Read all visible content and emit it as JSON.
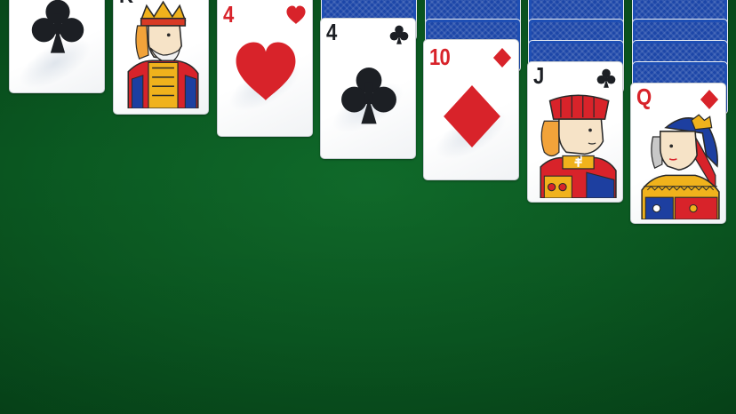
{
  "game": {
    "table_color": "#0b5a22",
    "card_back_color": "#1f4fb4"
  },
  "tableau": [
    {
      "column": 1,
      "face_down": 0,
      "face_up": [
        {
          "rank": "",
          "suit": "clubs",
          "color": "black"
        }
      ]
    },
    {
      "column": 2,
      "face_down": 0,
      "face_up": [
        {
          "rank": "K",
          "suit": "",
          "color": "black"
        }
      ]
    },
    {
      "column": 3,
      "face_down": 0,
      "face_up": [
        {
          "rank": "4",
          "suit": "hearts",
          "color": "red"
        }
      ]
    },
    {
      "column": 4,
      "face_down": 1,
      "face_up": [
        {
          "rank": "4",
          "suit": "clubs",
          "color": "black"
        }
      ]
    },
    {
      "column": 5,
      "face_down": 2,
      "face_up": [
        {
          "rank": "10",
          "suit": "diamonds",
          "color": "red"
        }
      ]
    },
    {
      "column": 6,
      "face_down": 3,
      "face_up": [
        {
          "rank": "J",
          "suit": "clubs",
          "color": "black"
        }
      ]
    },
    {
      "column": 7,
      "face_down": 4,
      "face_up": [
        {
          "rank": "Q",
          "suit": "diamonds",
          "color": "red"
        }
      ]
    }
  ],
  "icons": {
    "clubs": "clubs-icon",
    "hearts": "hearts-icon",
    "diamonds": "diamonds-icon",
    "king_portrait": "king-portrait-icon",
    "jack_portrait": "jack-portrait-icon",
    "queen_portrait": "queen-portrait-icon"
  }
}
